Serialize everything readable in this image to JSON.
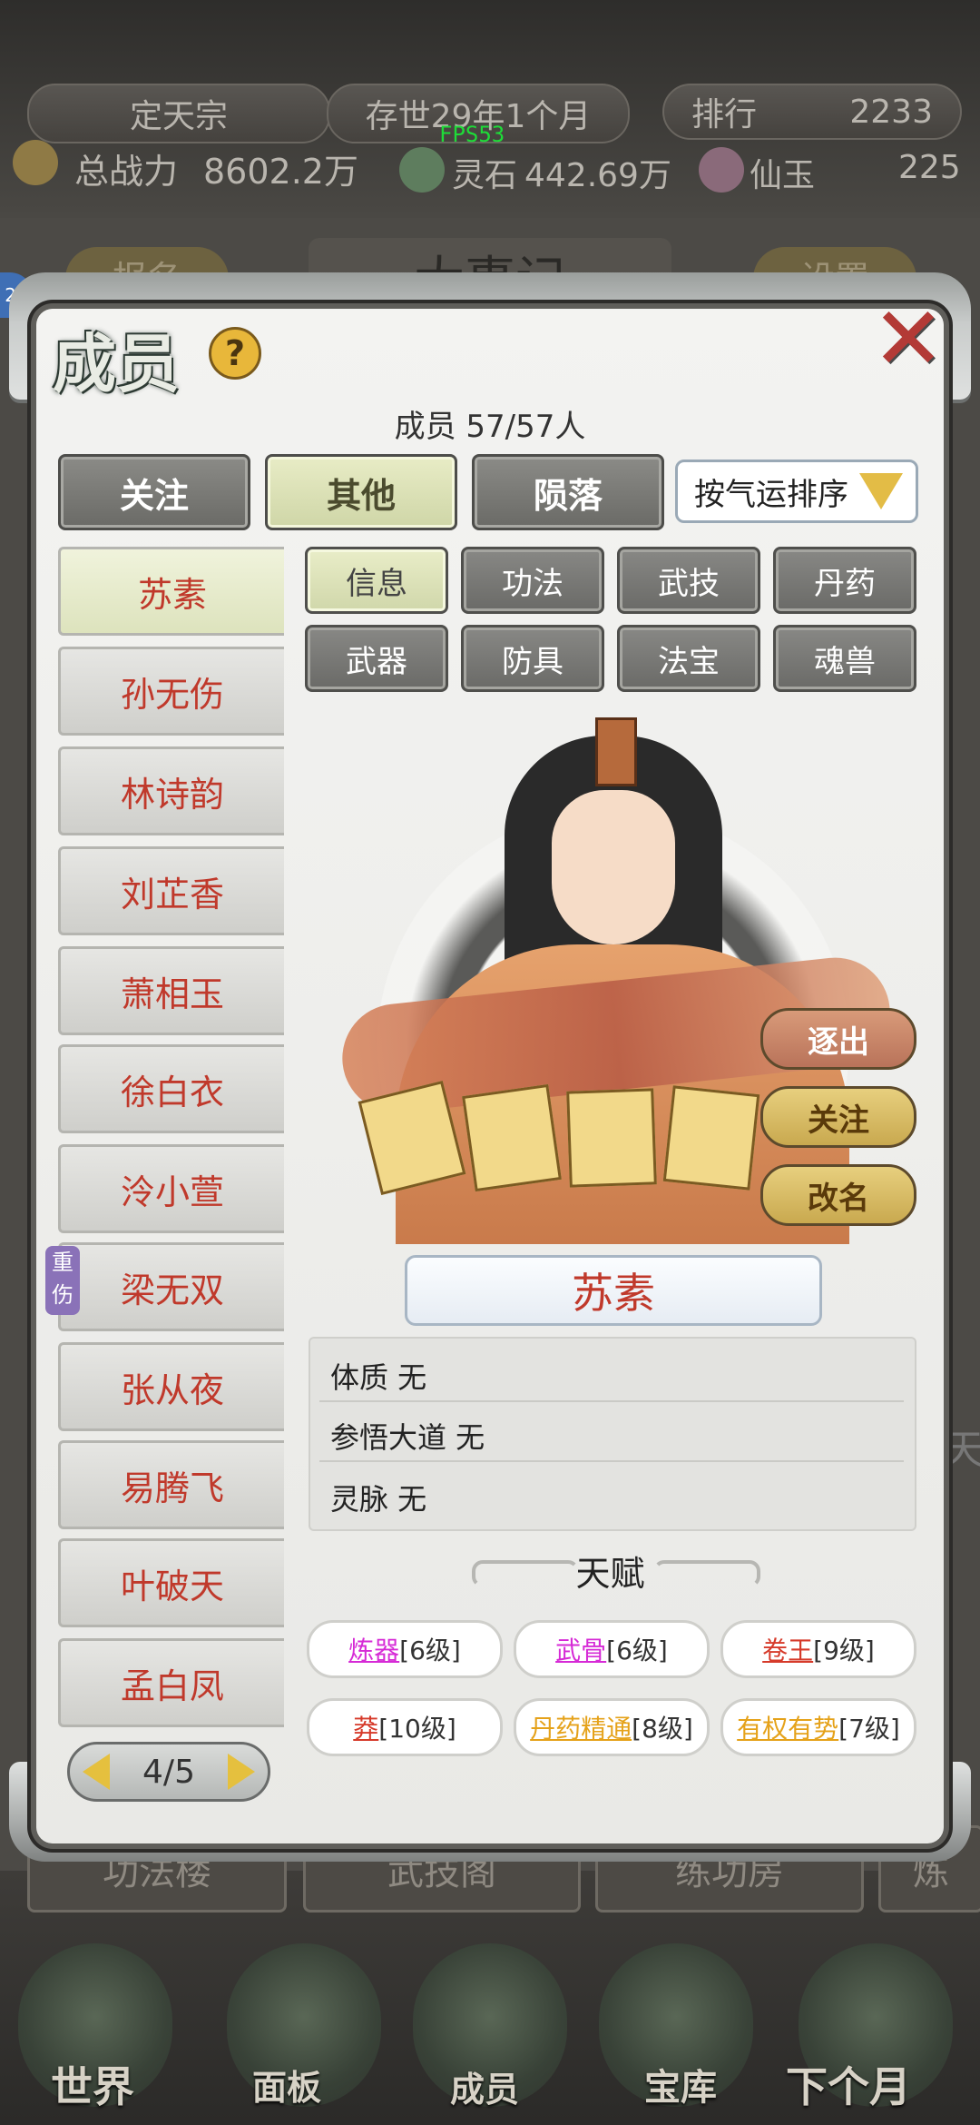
{
  "hud": {
    "sect": "定天宗",
    "age": "存世29年1个月",
    "rank_label": "排行",
    "rank_value": "2233",
    "power_label": "总战力",
    "power_value": "8602.2万",
    "fps": "FPS53",
    "stone_label": "灵石",
    "stone_value": "442.69万",
    "jade_label": "仙玉",
    "jade_value": "225",
    "badge": "22"
  },
  "background": {
    "left_btn": "报名",
    "center_title": "大事记",
    "right_btn": "设置",
    "buildings": [
      "功法楼",
      "武技阁",
      "练功房",
      "炼"
    ],
    "dock": [
      "世界",
      "面板",
      "成员",
      "宝库",
      "下个月"
    ],
    "right_edge": "天"
  },
  "panel": {
    "title": "成员",
    "help": "?",
    "count_label": "成员",
    "count_value": "57/57人"
  },
  "filter_tabs": [
    {
      "label": "关注",
      "active": false
    },
    {
      "label": "其他",
      "active": true
    },
    {
      "label": "陨落",
      "active": false
    }
  ],
  "sort": {
    "label": "按气运排序"
  },
  "members": [
    {
      "name": "苏素",
      "selected": true
    },
    {
      "name": "孙无伤",
      "selected": false
    },
    {
      "name": "林诗韵",
      "selected": false
    },
    {
      "name": "刘芷香",
      "selected": false
    },
    {
      "name": "萧相玉",
      "selected": false
    },
    {
      "name": "徐白衣",
      "selected": false
    },
    {
      "name": "泠小萱",
      "selected": false
    },
    {
      "name": "梁无双",
      "selected": false
    },
    {
      "name": "张从夜",
      "selected": false
    },
    {
      "name": "易腾飞",
      "selected": false
    },
    {
      "name": "叶破天",
      "selected": false
    },
    {
      "name": "孟白凤",
      "selected": false
    }
  ],
  "status_tag": "重伤",
  "pager": {
    "text": "4/5"
  },
  "detail_tabs": [
    {
      "label": "信息",
      "active": true
    },
    {
      "label": "功法",
      "active": false
    },
    {
      "label": "武技",
      "active": false
    },
    {
      "label": "丹药",
      "active": false
    },
    {
      "label": "武器",
      "active": false
    },
    {
      "label": "防具",
      "active": false
    },
    {
      "label": "法宝",
      "active": false
    },
    {
      "label": "魂兽",
      "active": false
    }
  ],
  "actions": {
    "expel": "逐出",
    "follow": "关注",
    "rename": "改名"
  },
  "selected_name": "苏素",
  "info": {
    "physique": "体质 无",
    "dao": "参悟大道 无",
    "vein": "灵脉 无"
  },
  "talent_title": "天赋",
  "talents": [
    {
      "name": "炼器",
      "level": "[6级]",
      "color": "#d62ad6"
    },
    {
      "name": "武骨",
      "level": "[6级]",
      "color": "#d62ad6"
    },
    {
      "name": "卷王",
      "level": "[9级]",
      "color": "#d63a2a"
    },
    {
      "name": "莽",
      "level": "[10级]",
      "color": "#d63a2a"
    },
    {
      "name": "丹药精通",
      "level": "[8级]",
      "color": "#e5a21a"
    },
    {
      "name": "有权有势",
      "level": "[7级]",
      "color": "#e5a21a"
    }
  ]
}
